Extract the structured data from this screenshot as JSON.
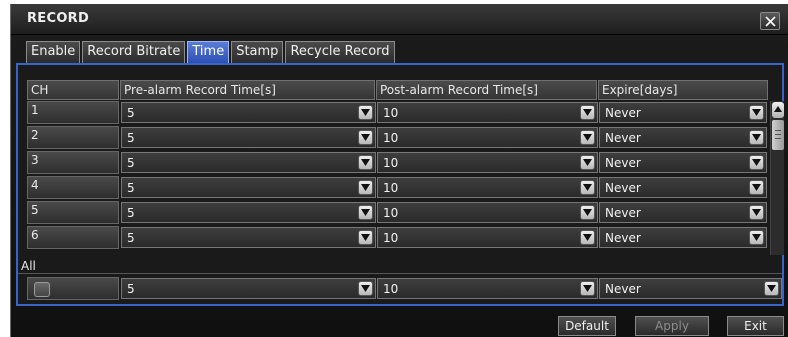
{
  "window": {
    "title": "RECORD",
    "close_icon": "close-icon"
  },
  "tabs": [
    {
      "label": "Enable",
      "active": false
    },
    {
      "label": "Record Bitrate",
      "active": false
    },
    {
      "label": "Time",
      "active": true
    },
    {
      "label": "Stamp",
      "active": false
    },
    {
      "label": "Recycle Record",
      "active": false
    }
  ],
  "table": {
    "headers": {
      "ch": "CH",
      "pre": "Pre-alarm Record Time[s]",
      "post": "Post-alarm Record Time[s]",
      "expire": "Expire[days]"
    },
    "rows": [
      {
        "ch": "1",
        "pre": "5",
        "post": "10",
        "expire": "Never"
      },
      {
        "ch": "2",
        "pre": "5",
        "post": "10",
        "expire": "Never"
      },
      {
        "ch": "3",
        "pre": "5",
        "post": "10",
        "expire": "Never"
      },
      {
        "ch": "4",
        "pre": "5",
        "post": "10",
        "expire": "Never"
      },
      {
        "ch": "5",
        "pre": "5",
        "post": "10",
        "expire": "Never"
      },
      {
        "ch": "6",
        "pre": "5",
        "post": "10",
        "expire": "Never"
      }
    ],
    "all": {
      "label": "All",
      "checked": false,
      "pre": "5",
      "post": "10",
      "expire": "Never"
    }
  },
  "buttons": {
    "default_label": "Default",
    "apply_label": "Apply",
    "exit_label": "Exit",
    "apply_disabled": true
  },
  "colors": {
    "active_tab": "#2b4fb3",
    "panel_border": "#3a63c8",
    "background": "#141414"
  }
}
